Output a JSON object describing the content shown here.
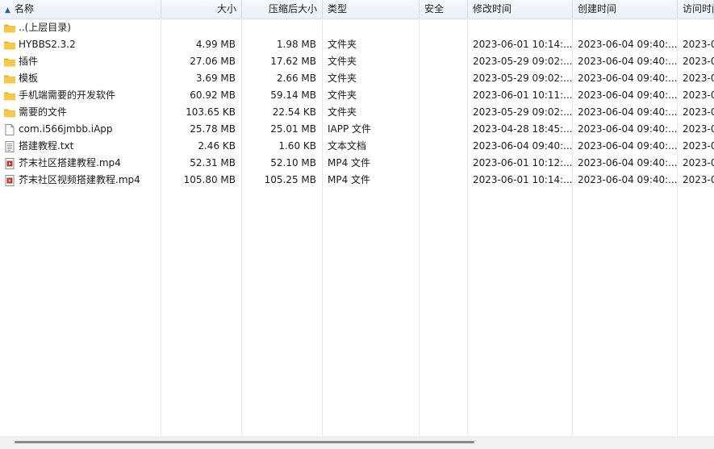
{
  "columns": {
    "name": "名称",
    "size": "大小",
    "packed": "压缩后大小",
    "type": "类型",
    "security": "安全",
    "modified": "修改时间",
    "created": "创建时间",
    "accessed": "访问时间"
  },
  "rows": [
    {
      "name": "..(上层目录)",
      "size": "",
      "packed": "",
      "type": "",
      "modified": "",
      "created": "",
      "accessed": "",
      "icon": "folder-icon"
    },
    {
      "name": "HYBBS2.3.2",
      "size": "4.99 MB",
      "packed": "1.98 MB",
      "type": "文件夹",
      "modified": "2023-06-01 10:14:...",
      "created": "2023-06-04 09:40:...",
      "accessed": "2023-0",
      "icon": "folder-icon"
    },
    {
      "name": "插件",
      "size": "27.06 MB",
      "packed": "17.62 MB",
      "type": "文件夹",
      "modified": "2023-05-29 09:02:...",
      "created": "2023-06-04 09:40:...",
      "accessed": "2023-0",
      "icon": "folder-icon"
    },
    {
      "name": "模板",
      "size": "3.69 MB",
      "packed": "2.66 MB",
      "type": "文件夹",
      "modified": "2023-05-29 09:02:...",
      "created": "2023-06-04 09:40:...",
      "accessed": "2023-0",
      "icon": "folder-icon"
    },
    {
      "name": "手机端需要的开发软件",
      "size": "60.92 MB",
      "packed": "59.14 MB",
      "type": "文件夹",
      "modified": "2023-06-01 10:11:...",
      "created": "2023-06-04 09:40:...",
      "accessed": "2023-0",
      "icon": "folder-icon"
    },
    {
      "name": "需要的文件",
      "size": "103.65 KB",
      "packed": "22.54 KB",
      "type": "文件夹",
      "modified": "2023-05-29 09:02:...",
      "created": "2023-06-04 09:40:...",
      "accessed": "2023-0",
      "icon": "folder-icon"
    },
    {
      "name": "com.i566jmbb.iApp",
      "size": "25.78 MB",
      "packed": "25.01 MB",
      "type": "IAPP 文件",
      "modified": "2023-04-28 18:45:...",
      "created": "2023-06-04 09:40:...",
      "accessed": "2023-0",
      "icon": "blank-file-icon"
    },
    {
      "name": "搭建教程.txt",
      "size": "2.46 KB",
      "packed": "1.60 KB",
      "type": "文本文档",
      "modified": "2023-06-04 09:40:...",
      "created": "2023-06-04 09:40:...",
      "accessed": "2023-0",
      "icon": "text-file-icon"
    },
    {
      "name": "芥末社区搭建教程.mp4",
      "size": "52.31 MB",
      "packed": "52.10 MB",
      "type": "MP4 文件",
      "modified": "2023-06-01 10:12:...",
      "created": "2023-06-04 09:40:...",
      "accessed": "2023-0",
      "icon": "video-file-icon"
    },
    {
      "name": "芥末社区视频搭建教程.mp4",
      "size": "105.80 MB",
      "packed": "105.25 MB",
      "type": "MP4 文件",
      "modified": "2023-06-01 10:14:...",
      "created": "2023-06-04 09:40:...",
      "accessed": "2023-0",
      "icon": "video-file-icon"
    }
  ],
  "sort": {
    "column": "name",
    "direction": "ascending",
    "icon": "sort-up-arrow-icon"
  },
  "colors": {
    "folder": "#f8c948",
    "header_bg": "#eef3fa",
    "grid": "#e3e8ee",
    "video_accent": "#c0392b"
  }
}
